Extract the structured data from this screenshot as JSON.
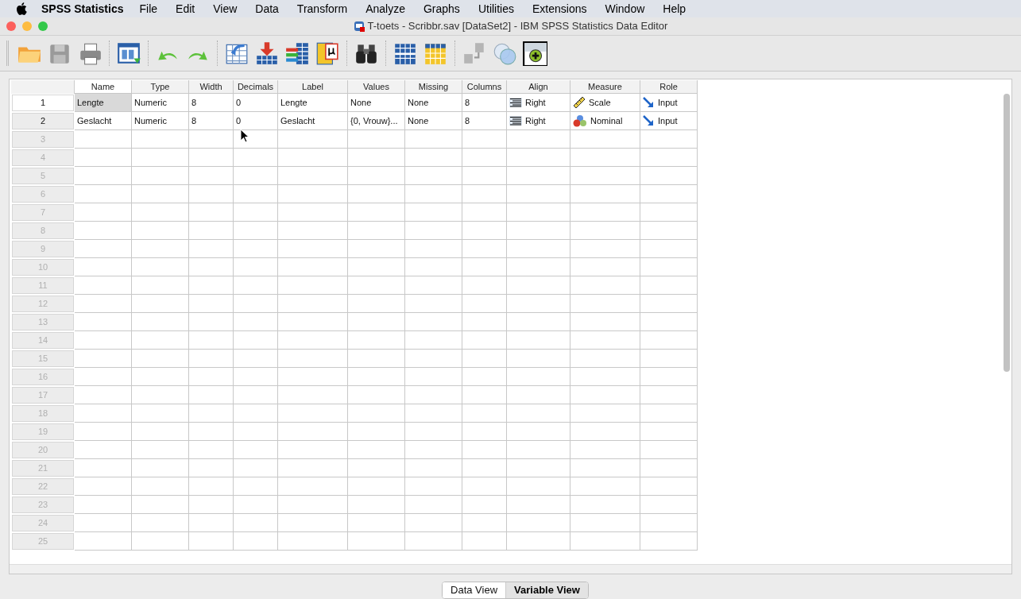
{
  "menu_bar": {
    "app": "SPSS Statistics",
    "items": [
      "File",
      "Edit",
      "View",
      "Data",
      "Transform",
      "Analyze",
      "Graphs",
      "Utilities",
      "Extensions",
      "Window",
      "Help"
    ]
  },
  "window": {
    "title": "T-toets - Scribbr.sav [DataSet2] - IBM SPSS Statistics Data Editor"
  },
  "grid": {
    "columns": [
      "Name",
      "Type",
      "Width",
      "Decimals",
      "Label",
      "Values",
      "Missing",
      "Columns",
      "Align",
      "Measure",
      "Role"
    ],
    "rows": [
      {
        "number": "1",
        "defined": true,
        "selected": true,
        "cells": [
          {
            "text": "Lengte",
            "selected": true
          },
          {
            "text": "Numeric",
            "selected": false
          },
          {
            "text": "8",
            "selected": false
          },
          {
            "text": "0",
            "selected": false
          },
          {
            "text": "Lengte",
            "selected": false
          },
          {
            "text": "None",
            "selected": false
          },
          {
            "text": "None",
            "selected": false
          },
          {
            "text": "8",
            "selected": false
          },
          {
            "text": "Right",
            "kind": "align-right",
            "selected": false
          },
          {
            "text": "Scale",
            "kind": "scale",
            "selected": false
          },
          {
            "text": "Input",
            "kind": "input",
            "selected": false
          }
        ]
      },
      {
        "number": "2",
        "defined": true,
        "selected": false,
        "cells": [
          {
            "text": "Geslacht",
            "selected": false
          },
          {
            "text": "Numeric",
            "selected": false
          },
          {
            "text": "8",
            "selected": false
          },
          {
            "text": "0",
            "selected": false
          },
          {
            "text": "Geslacht",
            "selected": false
          },
          {
            "text": "{0, Vrouw}...",
            "selected": false
          },
          {
            "text": "None",
            "selected": false
          },
          {
            "text": "8",
            "selected": false
          },
          {
            "text": "Right",
            "kind": "align-right",
            "selected": false
          },
          {
            "text": "Nominal",
            "kind": "nominal",
            "selected": false
          },
          {
            "text": "Input",
            "kind": "input",
            "selected": false
          }
        ]
      },
      {
        "number": "3",
        "defined": false,
        "selected": false
      },
      {
        "number": "4",
        "defined": false,
        "selected": false
      },
      {
        "number": "5",
        "defined": false,
        "selected": false
      },
      {
        "number": "6",
        "defined": false,
        "selected": false
      },
      {
        "number": "7",
        "defined": false,
        "selected": false
      },
      {
        "number": "8",
        "defined": false,
        "selected": false
      },
      {
        "number": "9",
        "defined": false,
        "selected": false
      },
      {
        "number": "10",
        "defined": false,
        "selected": false
      },
      {
        "number": "11",
        "defined": false,
        "selected": false
      },
      {
        "number": "12",
        "defined": false,
        "selected": false
      },
      {
        "number": "13",
        "defined": false,
        "selected": false
      },
      {
        "number": "14",
        "defined": false,
        "selected": false
      },
      {
        "number": "15",
        "defined": false,
        "selected": false
      },
      {
        "number": "16",
        "defined": false,
        "selected": false
      },
      {
        "number": "17",
        "defined": false,
        "selected": false
      },
      {
        "number": "18",
        "defined": false,
        "selected": false
      },
      {
        "number": "19",
        "defined": false,
        "selected": false
      },
      {
        "number": "20",
        "defined": false,
        "selected": false
      },
      {
        "number": "21",
        "defined": false,
        "selected": false
      },
      {
        "number": "22",
        "defined": false,
        "selected": false
      },
      {
        "number": "23",
        "defined": false,
        "selected": false
      },
      {
        "number": "24",
        "defined": false,
        "selected": false
      },
      {
        "number": "25",
        "defined": false,
        "selected": false
      }
    ]
  },
  "view_tabs": [
    {
      "label": "Data View",
      "selected": false
    },
    {
      "label": "Variable View",
      "selected": true
    }
  ]
}
